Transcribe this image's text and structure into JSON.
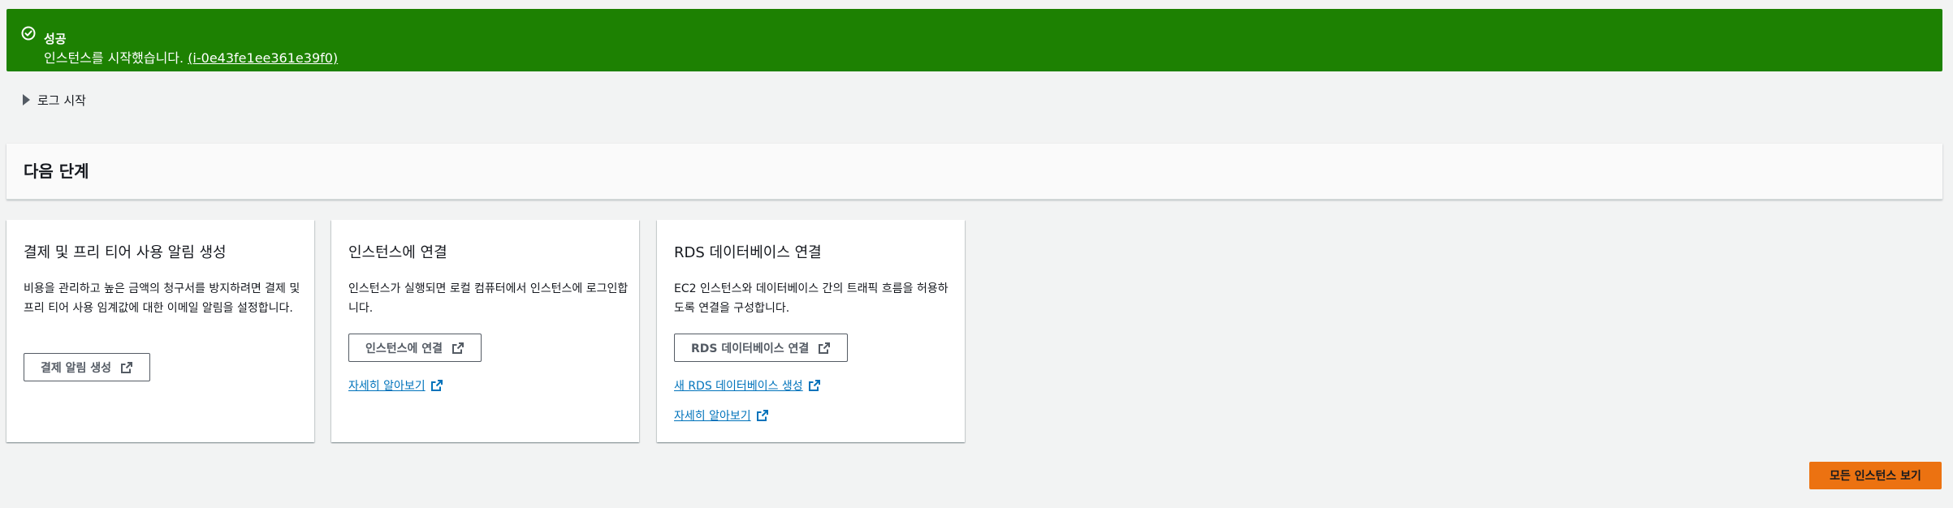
{
  "flash": {
    "title": "성공",
    "message_prefix": "인스턴스를 시작했습니다. ",
    "instance_link": "(i-0e43fe1ee361e39f0)",
    "icon": "check-circle-icon",
    "color": "#1d8102"
  },
  "logs": {
    "label": "로그 시작"
  },
  "next_steps": {
    "title": "다음 단계",
    "cards": [
      {
        "title": "결제 및 프리 티어 사용 알림 생성",
        "description": "비용을 관리하고 높은 금액의 청구서를 방지하려면 결제 및 프리 티어 사용 임계값에 대한 이메일 알림을 설정합니다.",
        "button": "결제 알림 생성"
      },
      {
        "title": "인스턴스에 연결",
        "description": "인스턴스가 실행되면 로컬 컴퓨터에서 인스턴스에 로그인합니다.",
        "button": "인스턴스에 연결",
        "link": "자세히 알아보기"
      },
      {
        "title": "RDS 데이터베이스 연결",
        "description": "EC2 인스턴스와 데이터베이스 간의 트래픽 흐름을 허용하도록 연결을 구성합니다.",
        "button": "RDS 데이터베이스 연결",
        "link1": "새 RDS 데이터베이스 생성",
        "link2": "자세히 알아보기"
      }
    ]
  },
  "footer": {
    "view_all_button": "모든 인스턴스 보기",
    "accent": "#ec7211"
  },
  "colors": {
    "link": "#0073bb",
    "background": "#f2f3f3"
  }
}
